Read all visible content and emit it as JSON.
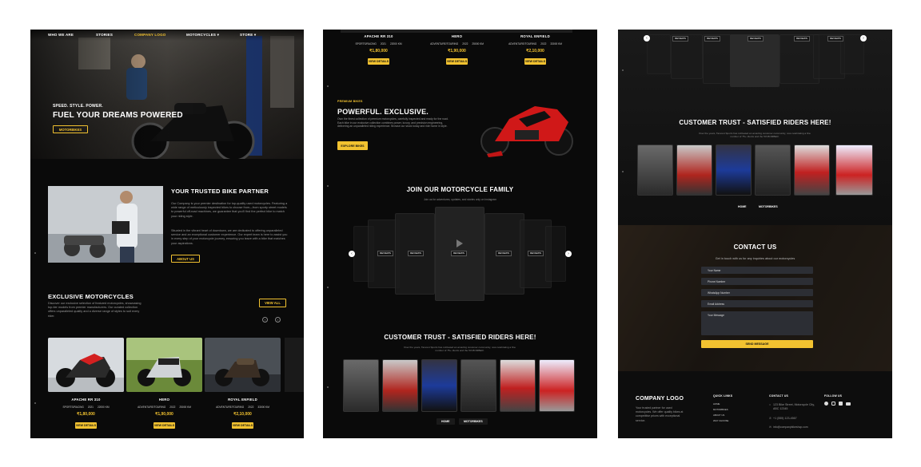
{
  "panel1": {
    "nav": {
      "who": "WHO WE ARE",
      "stories": "STORIES",
      "logo": "COMPANY LOGO",
      "motorcycles": "MOTORCYCLES ▾",
      "store": "STORE ▾"
    },
    "hero": {
      "tagline": "SPEED. STYLE. POWER.",
      "title": "FUEL YOUR DREAMS POWERED",
      "button": "MOTORBIKES"
    },
    "partner": {
      "title": "YOUR TRUSTED BIKE PARTNER",
      "p1": "Our Company is your premier destination for top-quality used motorcycles. Featuring a wide range of meticulously inspected bikes to choose from—from sporty street models to powerful off-road machines, we guarantee that you'll find the perfect bike to match your riding style.",
      "p2": "Situated in the vibrant heart of downtown, we are dedicated to offering unparalleled service and an exceptional customer experience. Our expert team is here to assist you in every step of your motorcycle journey, ensuring you leave with a bike that matches your aspirations.",
      "button": "ABOUT US"
    },
    "exclusive": {
      "title": "EXCLUSIVE MOTORCYCLES",
      "desc": "Discover our exclusive selection of featured motorcycles, showcasing top-tier models from premier manufacturers. Our curated collection offers unparalleled quality and a diverse range of styles to suit every rider.",
      "view_all": "VIEW ALL",
      "prev": "‹",
      "next": "›"
    },
    "bikes": [
      {
        "name": "APACHE RR 310",
        "type": "SPORTS/RACING",
        "year": "2021",
        "km": "22000 KM",
        "price": "₹1,80,000",
        "button": "VIEW DETAILS"
      },
      {
        "name": "HERO",
        "type": "ADVENTURE/TOURING",
        "year": "2022",
        "km": "25000 KM",
        "price": "₹1,90,000",
        "button": "VIEW DETAILS"
      },
      {
        "name": "ROYAL ENFIELD",
        "type": "ADVENTURE/TOURING",
        "year": "2022",
        "km": "33000 KM",
        "price": "₹2,10,000",
        "button": "VIEW DETAILS"
      }
    ]
  },
  "panel2": {
    "bikes": [
      {
        "name": "APACHE RR 310",
        "type": "SPORTS/RACING",
        "year": "2021",
        "km": "22000 KM",
        "price": "₹1,80,000",
        "button": "VIEW DETAILS"
      },
      {
        "name": "HERO",
        "type": "ADVENTURE/TOURING",
        "year": "2022",
        "km": "25000 KM",
        "price": "₹1,90,000",
        "button": "VIEW DETAILS"
      },
      {
        "name": "ROYAL ENFIELD",
        "type": "ADVENTURE/TOURING",
        "year": "2022",
        "km": "33000 KM",
        "price": "₹2,10,000",
        "button": "VIEW DETAILS"
      }
    ],
    "promo": {
      "kicker": "PREMIUM BIKES",
      "title": "POWERFUL. EXCLUSIVE.",
      "desc": "Own the finest collection of premium motorcycles, carefully inspected and ready for the road. Each bike in our exclusive collection combines power, luxury, and precision engineering, delivering an unparalleled riding experience. Browse our stock today and ride home in style.",
      "button": "EXPLORE BIKES"
    },
    "family": {
      "title": "JOIN OUR MOTORCYCLE FAMILY",
      "subtitle": "Join us for adventures, updates, and stories only on Instagram",
      "labels": [
        "REVIEWS",
        "REVIEWS",
        "REVIEWS",
        "REVIEWS",
        "REVIEWS"
      ],
      "prev": "‹",
      "next": "›"
    },
    "trust": {
      "title": "CUSTOMER TRUST - SATISFIED RIDERS HERE!",
      "subtitle": "Over the years, Tanvest Sports has cultivated an amazing customer community, now celebrating a fine number of 75+ clients and the 5th BOMBER.",
      "tabs": [
        "HOME",
        "MOTORBIKES"
      ]
    }
  },
  "panel3": {
    "carousel": {
      "labels": [
        "REVIEWS",
        "REVIEWS",
        "REVIEWS",
        "REVIEWS",
        "REVIEWS"
      ],
      "prev": "‹",
      "next": "›"
    },
    "trust": {
      "title": "CUSTOMER TRUST - SATISFIED RIDERS HERE!",
      "subtitle": "Over the years, Tanvest Sports has cultivated an amazing customer community, now celebrating a fine number of 75+ clients and the 5th BOMBER.",
      "tabs": [
        "HOME",
        "MOTORBIKES"
      ]
    },
    "contact": {
      "title": "CONTACT US",
      "subtitle": "Get in touch with us for any inquiries about our motorcycles",
      "fields": [
        "Your Name",
        "Phone Number",
        "WhatsApp Number",
        "Email Address",
        "Your Message"
      ],
      "button": "SEND MESSAGE"
    },
    "footer": {
      "logo": "COMPANY LOGO",
      "about": "Your trusted partner for used motorcycles. We offer quality bikes at competitive prices with exceptional service.",
      "quick_title": "QUICK LINKS",
      "quick": [
        "HOME",
        "MOTORBIKES",
        "ABOUT US",
        "WHY CHOOSE"
      ],
      "contact_title": "CONTACT US",
      "address": "123 Bike Street, Motorcycle City, ABC 12345",
      "phone": "+1 (555) 123-4567",
      "email": "info@companybikeshop.com",
      "follow_title": "FOLLOW US"
    }
  }
}
